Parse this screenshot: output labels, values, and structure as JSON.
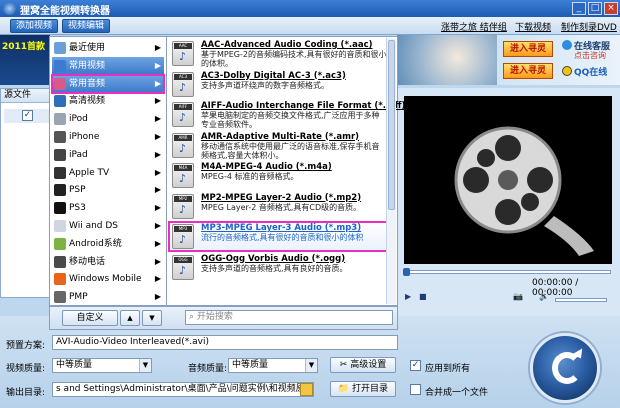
{
  "window": {
    "title": "狸窝全能视频转换器",
    "buttons": [
      "_",
      "□",
      "×"
    ]
  },
  "menubar": {
    "add_video": "添加视频",
    "edit_video": "视频编辑",
    "links": [
      "涨带之旅 结伴组",
      "下载视频",
      "制作刻录DVD"
    ]
  },
  "banner": {
    "left_text": "2011首款",
    "game_buttons": [
      "进入寻灵",
      "进入寻灵"
    ],
    "cs_title": "在线客服",
    "cs_line2": "点击咨询",
    "qq": "QQ在线"
  },
  "filelist": {
    "header": "源文件"
  },
  "categories": [
    {
      "label": "最近使用",
      "icon": "clock-icon",
      "color": "#6aa0d8",
      "has_arrow": true
    },
    {
      "label": "常用视频",
      "icon": "film-icon",
      "color": "#3c7bd0",
      "has_arrow": true
    },
    {
      "label": "常用音频",
      "icon": "music-icon",
      "color": "#d65a8a",
      "has_arrow": true
    },
    {
      "label": "高清视频",
      "icon": "hd-icon",
      "color": "#2f6fb9",
      "has_arrow": true
    },
    {
      "label": "iPod",
      "icon": "ipod-icon",
      "color": "#9aa5b1",
      "has_arrow": true
    },
    {
      "label": "iPhone",
      "icon": "iphone-icon",
      "color": "#555555",
      "has_arrow": true
    },
    {
      "label": "iPad",
      "icon": "ipad-icon",
      "color": "#444444",
      "has_arrow": true
    },
    {
      "label": "Apple TV",
      "icon": "appletv-icon",
      "color": "#333333",
      "has_arrow": true
    },
    {
      "label": "PSP",
      "icon": "psp-icon",
      "color": "#222222",
      "has_arrow": true
    },
    {
      "label": "PS3",
      "icon": "ps3-icon",
      "color": "#111111",
      "has_arrow": true
    },
    {
      "label": "Wii and DS",
      "icon": "wii-icon",
      "color": "#cfd6df",
      "has_arrow": true
    },
    {
      "label": "Android系统",
      "icon": "android-icon",
      "color": "#7cb342",
      "has_arrow": true
    },
    {
      "label": "移动电话",
      "icon": "phone-icon",
      "color": "#4a4a4a",
      "has_arrow": true
    },
    {
      "label": "Windows Mobile",
      "icon": "windows-icon",
      "color": "#e8641b",
      "has_arrow": true
    },
    {
      "label": "PMP",
      "icon": "pmp-icon",
      "color": "#666666",
      "has_arrow": true
    }
  ],
  "formats": [
    {
      "tag": "AAC",
      "name": "AAC-Advanced Audio Coding (*.aac)",
      "desc": "基于MPEG-2的音频编码技术,具有很好的音质和很小的体积。"
    },
    {
      "tag": "AC3",
      "name": "AC3-Dolby Digital AC-3 (*.ac3)",
      "desc": "支持多声道环绕声的数字音频格式。"
    },
    {
      "tag": "AIFF",
      "name": "AIFF-Audio Interchange File Format (*.aiff)",
      "desc": "苹果电脑制定的音频交换文件格式,广泛应用于多种专业音频软件。"
    },
    {
      "tag": "AMR",
      "name": "AMR-Adaptive Multi-Rate (*.amr)",
      "desc": "移动通信系统中使用最广泛的语音标准,保存手机音频格式,容量大体积小。"
    },
    {
      "tag": "M4A",
      "name": "M4A-MPEG-4 Audio (*.m4a)",
      "desc": "MPEG-4 标准的音频格式。"
    },
    {
      "tag": "MP2",
      "name": "MP2-MPEG Layer-2 Audio (*.mp2)",
      "desc": "MPEG Layer-2 音频格式,具有CD级的音质。"
    },
    {
      "tag": "MP3",
      "name": "MP3-MPEG Layer-3 Audio (*.mp3)",
      "desc": "流行的音频格式,具有很好的音质和很小的体积"
    },
    {
      "tag": "OGG",
      "name": "OGG-Ogg Vorbis Audio (*.ogg)",
      "desc": "支持多声道的音频格式,具有良好的音质。"
    }
  ],
  "menu_footer": {
    "custom": "自定义",
    "search_placeholder": "开始搜索"
  },
  "preview": {
    "timecode": "00:00:00 / 00:00:00"
  },
  "bottom": {
    "preset_label": "预置方案:",
    "preset_value": "AVI-Audio-Video Interleaved(*.avi)",
    "vq_label": "视频质量:",
    "vq_value": "中等质量",
    "aq_label": "音频质量:",
    "aq_value": "中等质量",
    "advanced": "高级设置",
    "apply_all": "应用到所有",
    "output_label": "输出目录:",
    "output_value": "s and Settings\\Administrator\\桌面\\产品\\问题实例\\和视频原件\\转换",
    "open_dir": "打开目录",
    "merge": "合并成一个文件"
  }
}
